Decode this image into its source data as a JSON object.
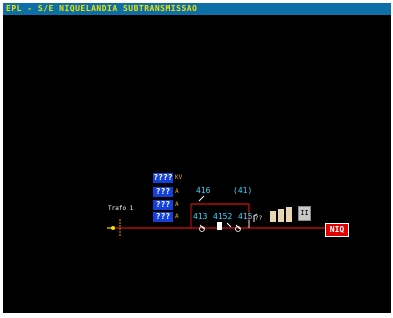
{
  "window": {
    "title": "EPL - S/E NIQUELANDIA SUBTRANSMISSAO"
  },
  "measurements": [
    {
      "value": "????",
      "unit": "KV"
    },
    {
      "value": "???",
      "unit": "A"
    },
    {
      "value": "???",
      "unit": "A"
    },
    {
      "value": "???",
      "unit": "A"
    }
  ],
  "transformer": {
    "label": "Trafo 1"
  },
  "breakers": {
    "b416": "416",
    "b41": "(41)",
    "b413": "413",
    "b4152": "4152",
    "b415": "415"
  },
  "indicator": "??",
  "control_button": "II",
  "feeder": {
    "label": "NIQ"
  },
  "colors": {
    "background": "#000000",
    "line": "#d01010",
    "title_bg": "#0c6fa8",
    "title_text": "#f0e000"
  }
}
